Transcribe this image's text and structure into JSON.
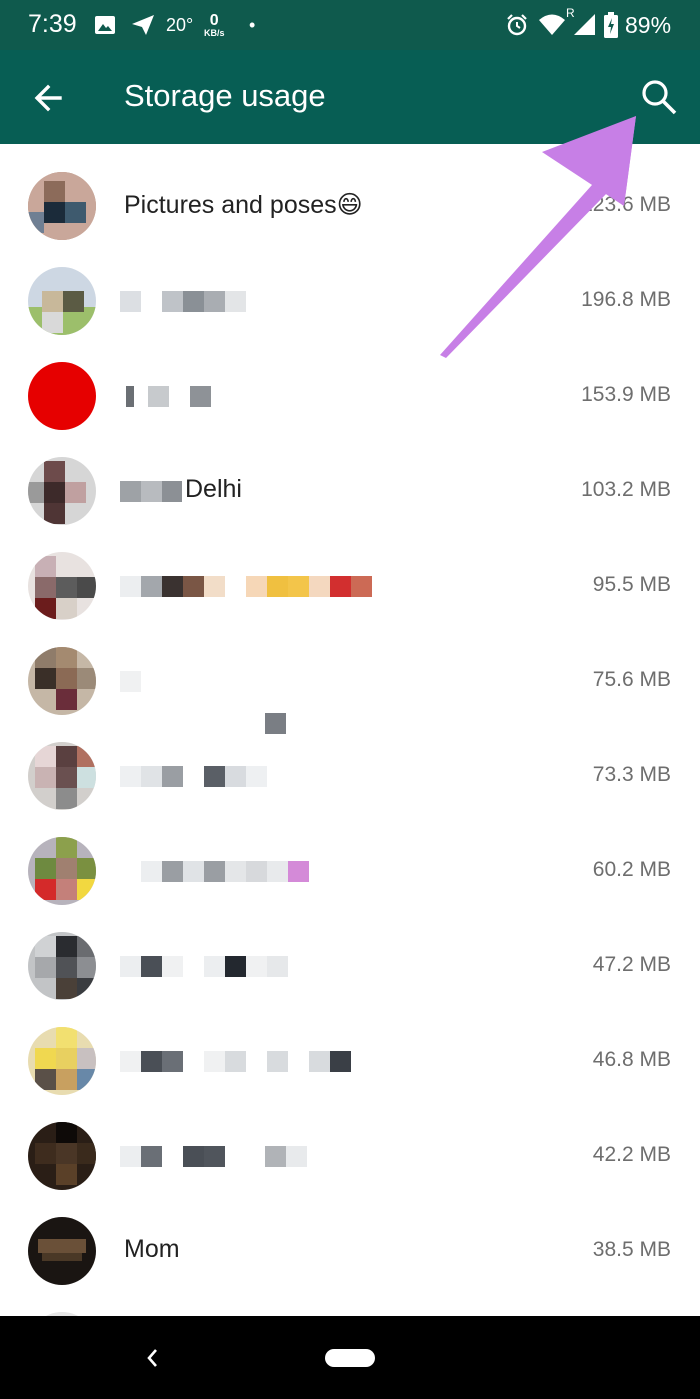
{
  "status_bar": {
    "time": "7:39",
    "temperature": "20°",
    "net_speed_value": "0",
    "net_speed_unit": "KB/s",
    "dot": "•",
    "roaming": "R",
    "battery": "89%",
    "icons": [
      "image-icon",
      "send-icon",
      "alarm-icon",
      "wifi-icon",
      "signal-icon",
      "battery-icon"
    ]
  },
  "app_bar": {
    "title": "Storage usage",
    "back_icon": "arrow-left-icon",
    "search_icon": "search-icon",
    "color": "#075e54"
  },
  "chats": [
    {
      "name": "Pictures and poses😄",
      "size": "123.6 MB"
    },
    {
      "name": "",
      "size": "196.8 MB"
    },
    {
      "name": "",
      "size": "153.9 MB"
    },
    {
      "name": "Delhi",
      "size": "103.2 MB"
    },
    {
      "name": "",
      "size": "95.5 MB"
    },
    {
      "name": "",
      "size": "75.6 MB"
    },
    {
      "name": "",
      "size": "73.3 MB"
    },
    {
      "name": "",
      "size": "60.2 MB"
    },
    {
      "name": "",
      "size": "47.2 MB"
    },
    {
      "name": "",
      "size": "46.8 MB"
    },
    {
      "name": "",
      "size": "42.2 MB"
    },
    {
      "name": "Mom",
      "size": "38.5 MB"
    }
  ],
  "annotation": {
    "type": "arrow",
    "color": "#c77fe6",
    "points_to": "search-icon"
  },
  "nav_bar": {
    "icons": [
      "nav-back-icon",
      "home-pill-icon"
    ]
  }
}
